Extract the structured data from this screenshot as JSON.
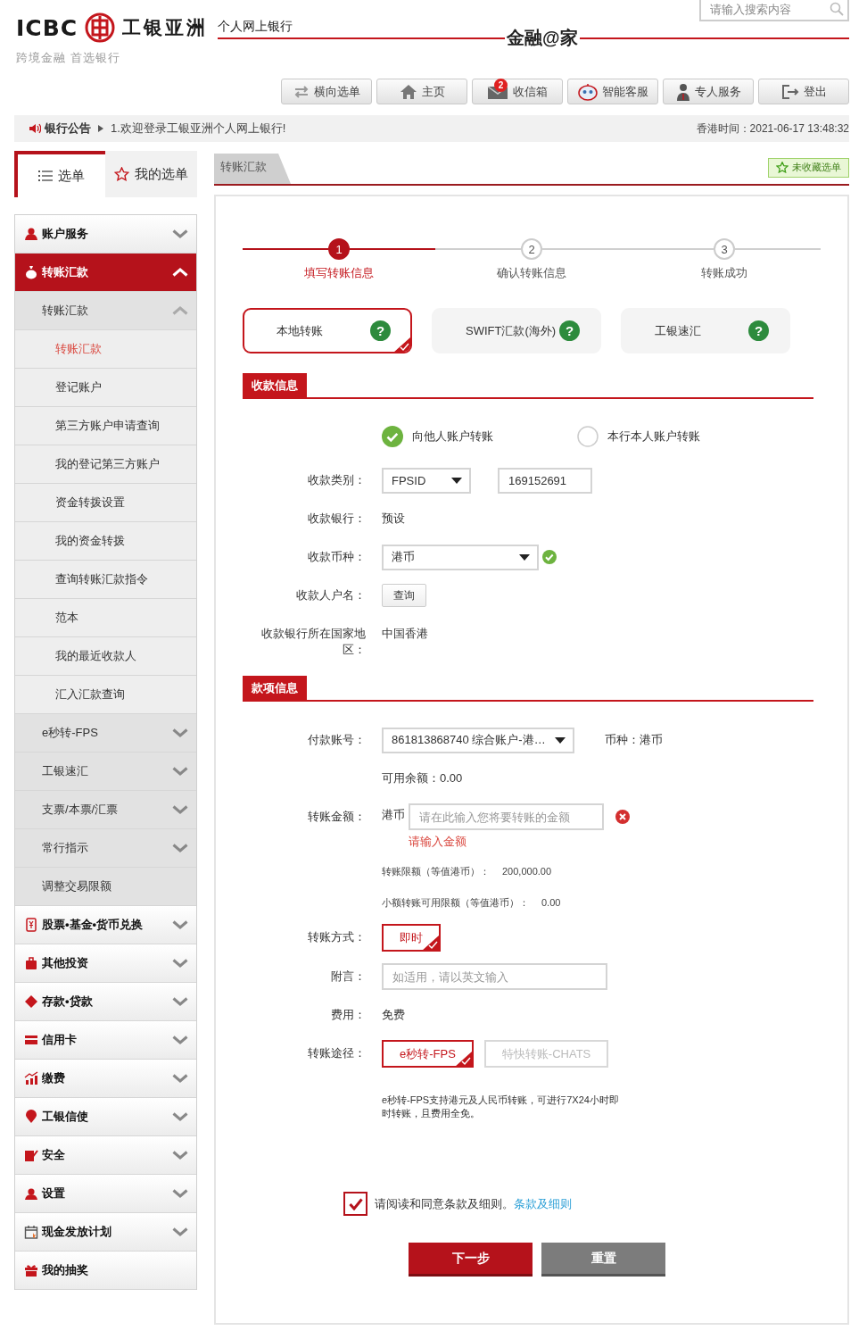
{
  "header": {
    "logo_text": "ICBC",
    "bank_name": "工银亚洲",
    "tagline": "跨境金融 首选银行",
    "portal_title": "个人网上银行",
    "slogan": "金融@家",
    "search": {
      "placeholder": "请输入搜索内容"
    }
  },
  "nav": [
    {
      "label": "横向选单"
    },
    {
      "label": "主页"
    },
    {
      "label": "收信箱",
      "badge": "2"
    },
    {
      "label": "智能客服"
    },
    {
      "label": "专人服务"
    },
    {
      "label": "登出"
    }
  ],
  "notice": {
    "title": "银行公告",
    "message": "1.欢迎登录工银亚洲个人网上银行!",
    "time": "香港时间：2021-06-17 13:48:32"
  },
  "sidebar_tabs": [
    {
      "label": "选单",
      "selected": true
    },
    {
      "label": "我的选单",
      "selected": false
    }
  ],
  "menu": [
    {
      "label": "账户服务",
      "kind": "group",
      "expanded": false
    },
    {
      "label": "转账汇款",
      "kind": "group",
      "expanded": true,
      "children": [
        {
          "label": "转账汇款",
          "kind": "group",
          "expanded": true,
          "children": [
            {
              "label": "转账汇款",
              "selected": true
            },
            {
              "label": "登记账户",
              "selected": false
            },
            {
              "label": "第三方账户申请查询",
              "selected": false
            },
            {
              "label": "我的登记第三方账户",
              "selected": false
            },
            {
              "label": "资金转拨设置",
              "selected": false
            },
            {
              "label": "我的资金转拨",
              "selected": false
            },
            {
              "label": "查询转账汇款指令",
              "selected": false
            },
            {
              "label": "范本",
              "selected": false
            },
            {
              "label": "我的最近收款人",
              "selected": false
            },
            {
              "label": "汇入汇款查询",
              "selected": false
            }
          ]
        },
        {
          "label": "e秒转-FPS",
          "kind": "group",
          "expanded": false
        },
        {
          "label": "工银速汇",
          "kind": "group",
          "expanded": false
        },
        {
          "label": "支票/本票/汇票",
          "kind": "group",
          "expanded": false
        },
        {
          "label": "常行指示",
          "kind": "group",
          "expanded": false
        },
        {
          "label": "调整交易限额",
          "kind": "link"
        }
      ]
    },
    {
      "label": "股票•基金•货币兑换",
      "kind": "group",
      "expanded": false
    },
    {
      "label": "其他投资",
      "kind": "group",
      "expanded": false
    },
    {
      "label": "存款•贷款",
      "kind": "group",
      "expanded": false
    },
    {
      "label": "信用卡",
      "kind": "group",
      "expanded": false
    },
    {
      "label": "缴费",
      "kind": "group",
      "expanded": false
    },
    {
      "label": "工银信使",
      "kind": "group",
      "expanded": false
    },
    {
      "label": "安全",
      "kind": "group",
      "expanded": false
    },
    {
      "label": "设置",
      "kind": "group",
      "expanded": false
    },
    {
      "label": "现金发放计划",
      "kind": "group",
      "expanded": false
    },
    {
      "label": "我的抽奖",
      "kind": "link"
    }
  ],
  "breadcrumb": "转账汇款",
  "favorite_button": "未收藏选单",
  "steps": [
    {
      "number": "1",
      "label": "填写转账信息",
      "selected": true
    },
    {
      "number": "2",
      "label": "确认转账信息",
      "selected": false
    },
    {
      "number": "3",
      "label": "转账成功",
      "selected": false
    }
  ],
  "transfer_types": [
    {
      "label": "本地转账",
      "help": "?",
      "selected": true
    },
    {
      "label": "SWIFT汇款(海外)",
      "help": "?",
      "selected": false
    },
    {
      "label": "工银速汇",
      "help": "?",
      "selected": false
    }
  ],
  "receiver": {
    "title": "收款信息",
    "recipient_type": [
      {
        "label": "向他人账户转账",
        "selected": true
      },
      {
        "label": "本行本人账户转账",
        "selected": false
      }
    ],
    "rows": [
      {
        "kind": "select_input",
        "label": "收款类别：",
        "select": "FPSID",
        "value": "169152691"
      },
      {
        "kind": "text",
        "label": "收款银行：",
        "value": "预设"
      },
      {
        "kind": "select",
        "label": "收款币种：",
        "select": "港币",
        "valid": true
      },
      {
        "kind": "button",
        "label": "收款人户名：",
        "button": "查询"
      },
      {
        "kind": "text",
        "label": "收款银行所在国家地区：",
        "value": "中国香港"
      }
    ]
  },
  "payment": {
    "title": "款项信息",
    "rows": [
      {
        "kind": "select",
        "label": "付款账号：",
        "select": "861813868740 综合账户-港…",
        "aside": "币种：港币"
      },
      {
        "kind": "text",
        "value": "可用余额：0.00"
      },
      {
        "kind": "amount",
        "label": "转账金额：",
        "currency": "港币",
        "placeholder": "请在此输入您将要转账的金额",
        "error": "请输入金额"
      },
      {
        "kind": "limit",
        "name": "转账限额（等值港币）：",
        "value": "200,000.00"
      },
      {
        "kind": "limit",
        "name": "小额转账可用限额（等值港币）：",
        "value": "0.00"
      },
      {
        "kind": "options",
        "label": "转账方式：",
        "options": [
          {
            "label": "即时",
            "selected": true
          }
        ]
      },
      {
        "kind": "input",
        "label": "附言：",
        "placeholder": "如适用，请以英文输入"
      },
      {
        "kind": "text",
        "label": "费用：",
        "value": "免费"
      },
      {
        "kind": "options",
        "label": "转账途径：",
        "options": [
          {
            "label": "e秒转-FPS",
            "selected": true
          },
          {
            "label": "特快转账-CHATS",
            "selected": false
          }
        ]
      },
      {
        "kind": "note",
        "value": "e秒转-FPS支持港元及人民币转账，可进行7X24小时即时转账，且费用全免。"
      }
    ]
  },
  "agreement": {
    "checked": true,
    "text": "请阅读和同意条款及细则。",
    "link": "条款及细则"
  },
  "buttons": [
    {
      "label": "下一步",
      "kind": "primary"
    },
    {
      "label": "重置",
      "kind": "secondary"
    }
  ]
}
